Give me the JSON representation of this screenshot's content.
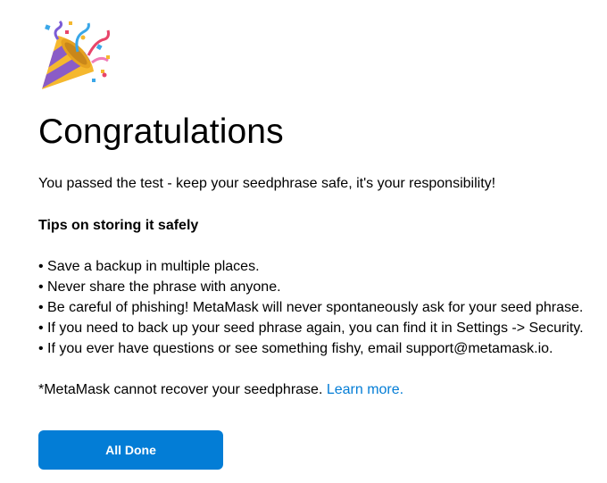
{
  "icon": "party-popper-icon",
  "title": "Congratulations",
  "intro": "You passed the test - keep your seedphrase safe, it's your responsibility!",
  "tips": {
    "heading": "Tips on storing it safely",
    "items": [
      "• Save a backup in multiple places.",
      "• Never share the phrase with anyone.",
      "• Be careful of phishing! MetaMask will never spontaneously ask for your seed phrase.",
      "• If you need to back up your seed phrase again, you can find it in Settings -> Security.",
      "• If you ever have questions or see something fishy, email support@metamask.io."
    ]
  },
  "disclaimer": {
    "text": "*MetaMask cannot recover your seedphrase. ",
    "link": "Learn more."
  },
  "button": {
    "label": "All Done"
  },
  "colors": {
    "accent": "#037dd6",
    "text": "#000000",
    "background": "#ffffff"
  }
}
